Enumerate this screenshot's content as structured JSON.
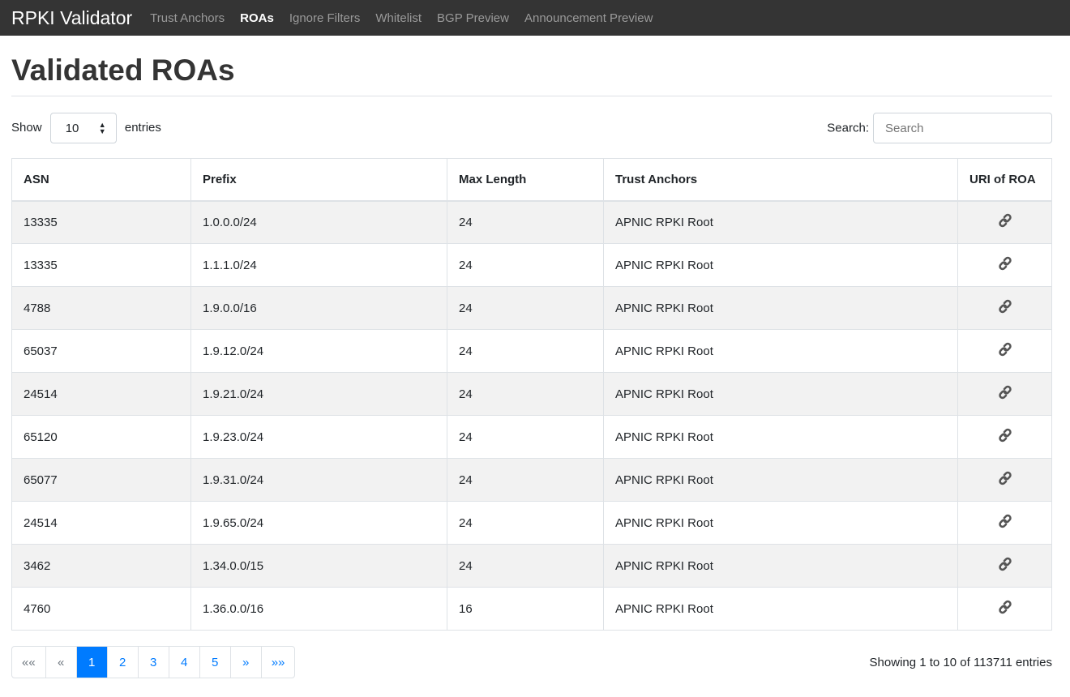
{
  "nav": {
    "brand": "RPKI Validator",
    "items": [
      "Trust Anchors",
      "ROAs",
      "Ignore Filters",
      "Whitelist",
      "BGP Preview",
      "Announcement Preview"
    ],
    "active": "ROAs"
  },
  "page": {
    "title": "Validated ROAs"
  },
  "controls": {
    "show": "Show",
    "entries_value": "10",
    "entries": "entries",
    "search_label": "Search:",
    "search_placeholder": "Search"
  },
  "table": {
    "headers": [
      "ASN",
      "Prefix",
      "Max Length",
      "Trust Anchors",
      "URI of ROA"
    ],
    "rows": [
      [
        "13335",
        "1.0.0.0/24",
        "24",
        "APNIC RPKI Root"
      ],
      [
        "13335",
        "1.1.1.0/24",
        "24",
        "APNIC RPKI Root"
      ],
      [
        "4788",
        "1.9.0.0/16",
        "24",
        "APNIC RPKI Root"
      ],
      [
        "65037",
        "1.9.12.0/24",
        "24",
        "APNIC RPKI Root"
      ],
      [
        "24514",
        "1.9.21.0/24",
        "24",
        "APNIC RPKI Root"
      ],
      [
        "65120",
        "1.9.23.0/24",
        "24",
        "APNIC RPKI Root"
      ],
      [
        "65077",
        "1.9.31.0/24",
        "24",
        "APNIC RPKI Root"
      ],
      [
        "24514",
        "1.9.65.0/24",
        "24",
        "APNIC RPKI Root"
      ],
      [
        "3462",
        "1.34.0.0/15",
        "24",
        "APNIC RPKI Root"
      ],
      [
        "4760",
        "1.36.0.0/16",
        "16",
        "APNIC RPKI Root"
      ]
    ],
    "uri_icon": "link-icon"
  },
  "pagination": {
    "items": [
      "««",
      "«",
      "1",
      "2",
      "3",
      "4",
      "5",
      "»",
      "»»"
    ],
    "active": "1",
    "accent": "#007bff"
  },
  "info": "Showing 1 to 10 of 113711 entries"
}
